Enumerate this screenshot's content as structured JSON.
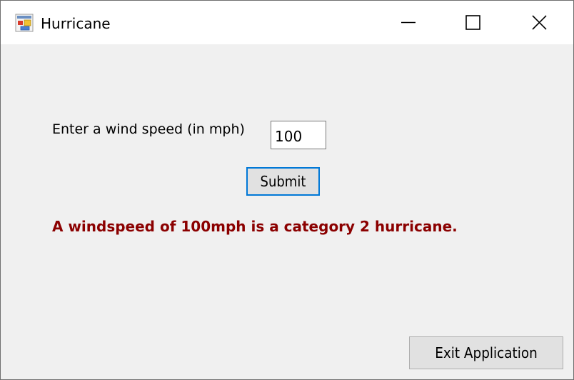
{
  "window": {
    "title": "Hurricane",
    "icon": "app-form-icon",
    "controls": {
      "minimize_icon": "minimize-icon",
      "maximize_icon": "maximize-icon",
      "close_icon": "close-icon"
    }
  },
  "form": {
    "wind_label": "Enter a wind speed (in mph)",
    "wind_speed_value": "100",
    "submit_label": "Submit",
    "result_message": "A windspeed of 100mph is a category 2 hurricane.",
    "exit_label": "Exit Application"
  },
  "colors": {
    "window_background": "#f0f0f0",
    "titlebar_background": "#ffffff",
    "result_text": "#8b0000",
    "focus_border": "#0078d7",
    "button_background": "#e1e1e1"
  }
}
